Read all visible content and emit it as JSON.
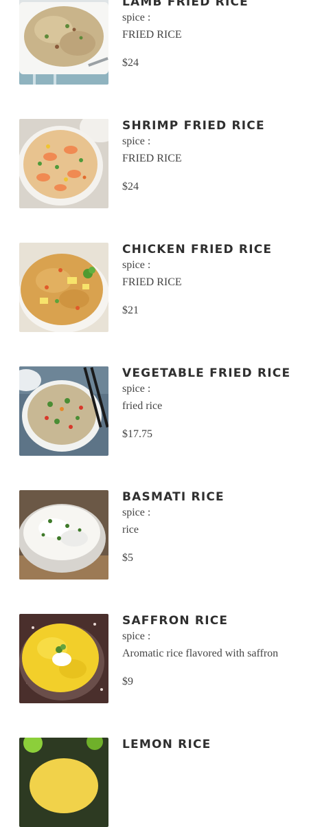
{
  "menu": {
    "items": [
      {
        "name": "LAMB FRIED RICE",
        "spice": "spice :",
        "description": "FRIED RICE",
        "price": "$24",
        "image": "lamb-fried-rice-photo"
      },
      {
        "name": "SHRIMP FRIED RICE",
        "spice": "spice :",
        "description": "FRIED RICE",
        "price": "$24",
        "image": "shrimp-fried-rice-photo"
      },
      {
        "name": "CHICKEN FRIED RICE",
        "spice": "spice :",
        "description": "FRIED RICE",
        "price": "$21",
        "image": "chicken-fried-rice-photo"
      },
      {
        "name": "VEGETABLE FRIED RICE",
        "spice": "spice :",
        "description": "fried rice",
        "price": "$17.75",
        "image": "vegetable-fried-rice-photo"
      },
      {
        "name": "BASMATI RICE",
        "spice": "spice :",
        "description": "rice",
        "price": "$5",
        "image": "basmati-rice-photo"
      },
      {
        "name": "SAFFRON RICE",
        "spice": "spice :",
        "description": "Aromatic rice flavored with saffron",
        "price": "$9",
        "image": "saffron-rice-photo"
      },
      {
        "name": "LEMON RICE",
        "image": "lemon-rice-photo"
      }
    ]
  }
}
